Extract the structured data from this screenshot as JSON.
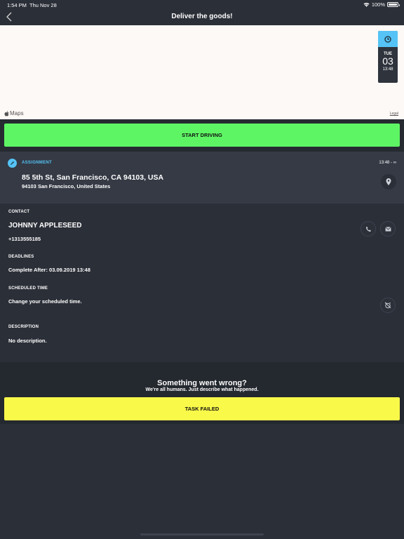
{
  "status_bar": {
    "time": "1:54 PM",
    "date": "Thu Nov 28",
    "battery": "100%",
    "icons": [
      "wifi-icon",
      "battery-icon"
    ]
  },
  "nav": {
    "title": "Deliver the goods!",
    "back_icon": "chevron-left-icon"
  },
  "map": {
    "logo": "Maps",
    "legal": "Legal",
    "date_card": {
      "weekday": "TUE",
      "day": "03",
      "time": "13:48",
      "icon": "clock-icon"
    }
  },
  "actions": {
    "start_driving": "START DRIVING"
  },
  "assignment": {
    "label": "ASSIGNMENT",
    "time": "13:48 - ∞",
    "address_line1": "85 5th St, San Francisco, CA 94103, USA",
    "address_line2": "94103 San Francisco, United States",
    "pin_icon": "location-pin-icon"
  },
  "contact": {
    "label": "CONTACT",
    "name": "JOHNNY APPLESEED",
    "phone": "+1313555185"
  },
  "deadlines": {
    "label": "DEADLINES",
    "value": "Complete After: 03.09.2019 13:48"
  },
  "scheduled": {
    "label": "SCHEDULED TIME",
    "value": "Change your scheduled time."
  },
  "description": {
    "label": "DESCRIPTION",
    "value": "No description."
  },
  "failure": {
    "heading": "Something went wrong?",
    "subheading": "We're all humans. Just describe what happened.",
    "button": "TASK FAILED"
  },
  "colors": {
    "accent_blue": "#55c3f5",
    "start_green": "#5ef565",
    "fail_yellow": "#f9f94a",
    "background": "#2b2f38"
  }
}
